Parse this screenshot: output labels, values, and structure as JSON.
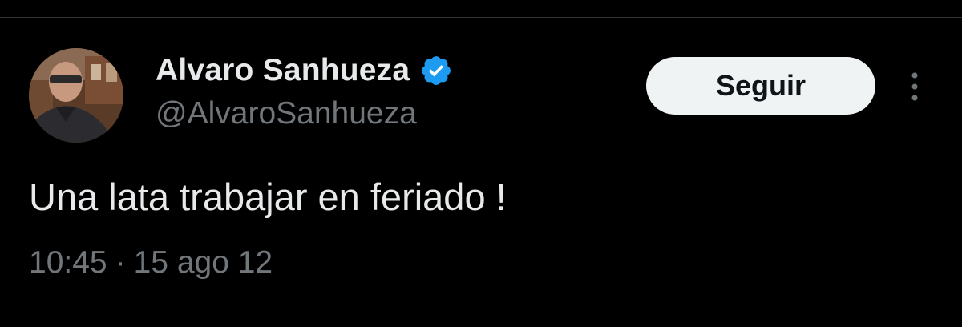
{
  "tweet": {
    "author": {
      "display_name": "Alvaro Sanhueza",
      "handle": "@AlvaroSanhueza",
      "verified": true,
      "verified_color": "#1d9bf0"
    },
    "follow_label": "Seguir",
    "text": "Una lata trabajar en feriado !",
    "time": "10:45",
    "separator": "·",
    "date": "15 ago 12"
  },
  "icons": {
    "verified": "verified-badge-icon",
    "more": "more-options-icon"
  },
  "colors": {
    "background": "#000000",
    "primary_text": "#e7e9ea",
    "secondary_text": "#71767b",
    "button_bg": "#eff3f4",
    "button_text": "#0f1419"
  }
}
